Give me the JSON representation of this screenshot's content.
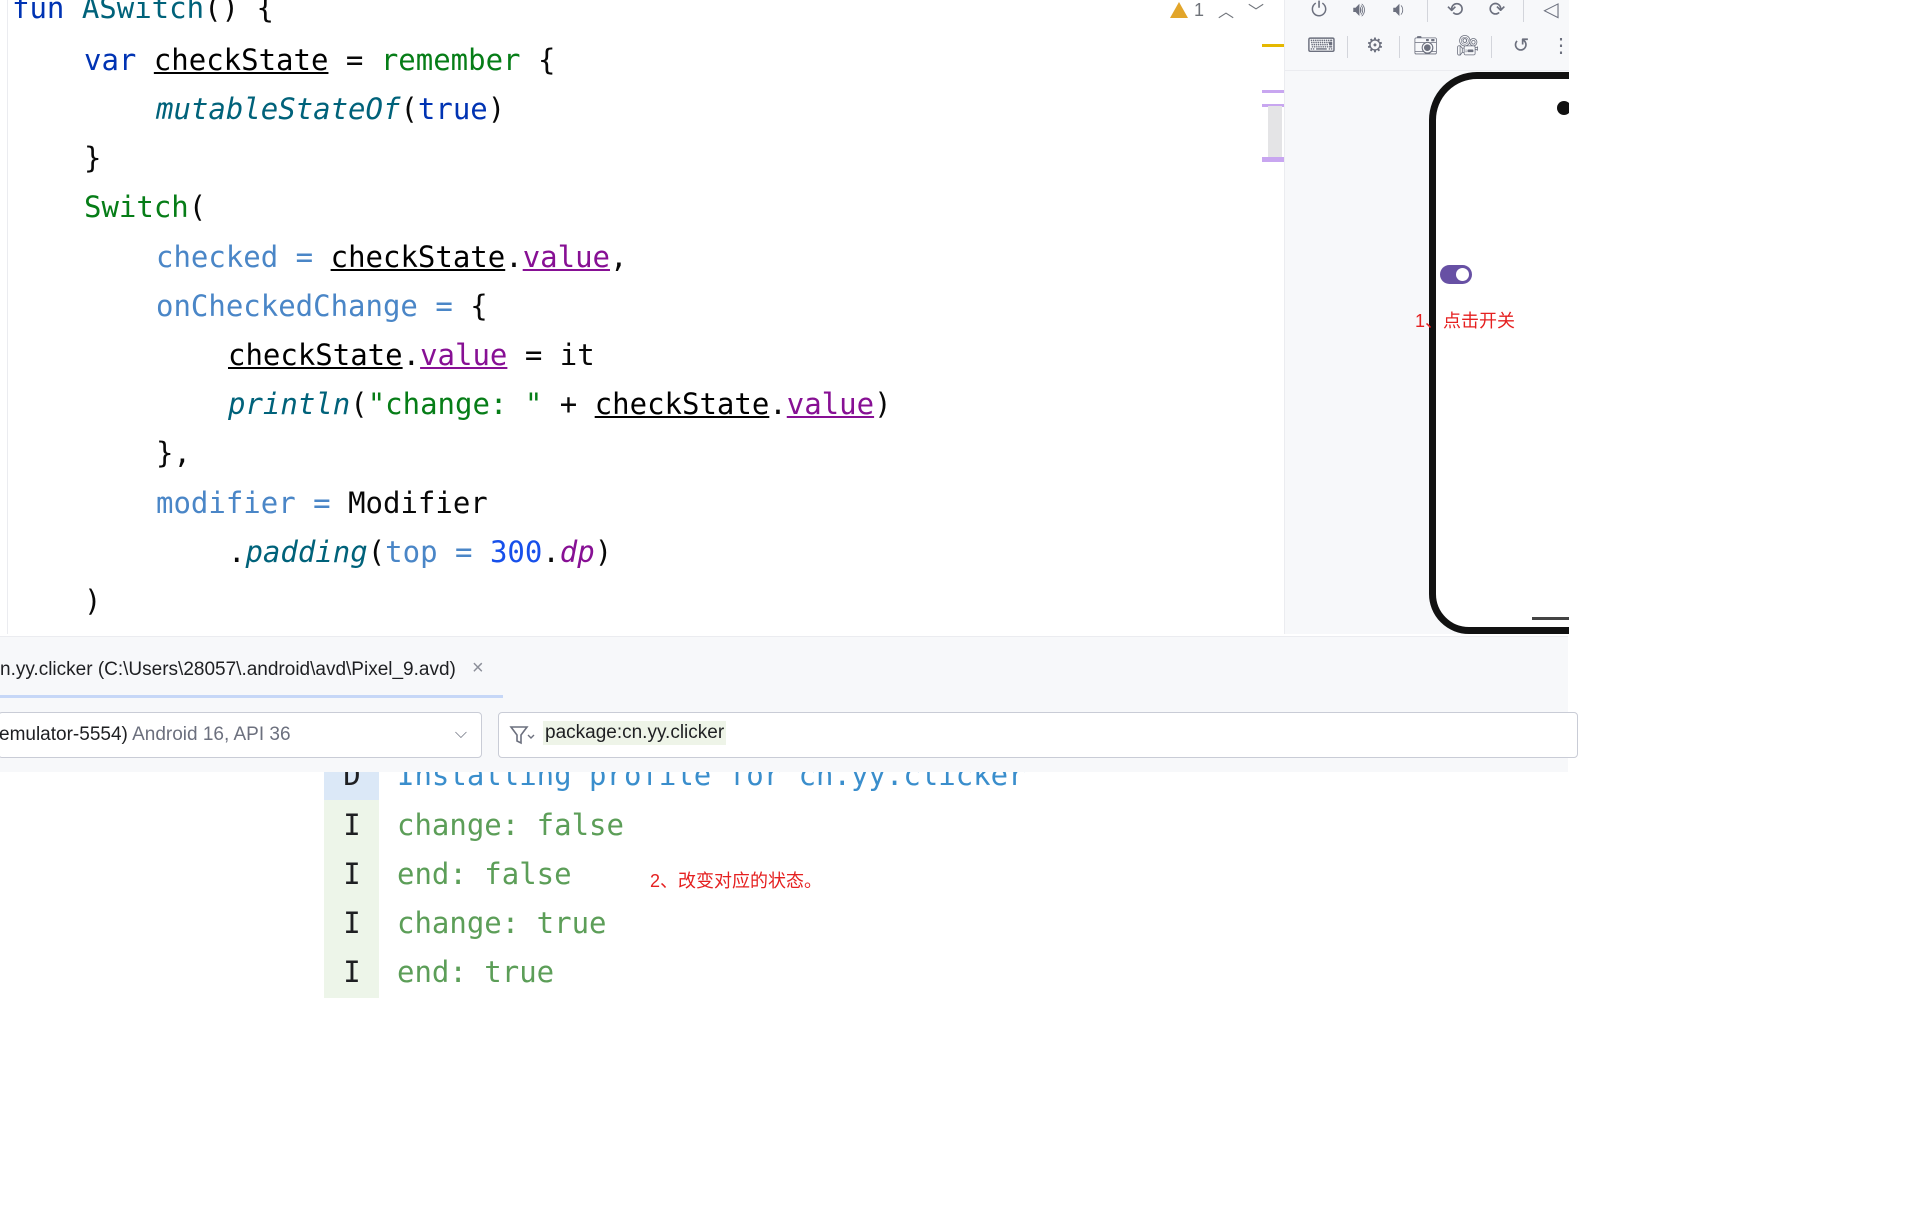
{
  "editor": {
    "lines": [
      {
        "parts": [
          [
            "kw",
            "fun "
          ],
          [
            "fn",
            "ASwitch"
          ],
          [
            "",
            "() {"
          ]
        ]
      },
      {
        "parts": [
          [
            "kw",
            "var "
          ],
          [
            "var",
            "checkState"
          ],
          [
            "",
            " = "
          ],
          [
            "fnc",
            "remember"
          ],
          [
            "",
            " {"
          ]
        ]
      },
      {
        "parts": [
          [
            "it",
            "mutableStateOf"
          ],
          [
            "",
            "("
          ],
          [
            "kw",
            "true"
          ],
          [
            "",
            ")"
          ]
        ]
      },
      {
        "parts": [
          [
            "",
            "}"
          ]
        ]
      },
      {
        "parts": [
          [
            "fnc",
            "Switch"
          ],
          [
            "",
            "("
          ]
        ]
      },
      {
        "parts": [
          [
            "param",
            "checked"
          ],
          [
            "param",
            " = "
          ],
          [
            "var",
            "checkState"
          ],
          [
            "",
            "."
          ],
          [
            "prop",
            "value"
          ],
          [
            "",
            ","
          ]
        ]
      },
      {
        "parts": [
          [
            "param",
            "onCheckedChange"
          ],
          [
            "param",
            " = "
          ],
          [
            "",
            "{"
          ]
        ]
      },
      {
        "parts": [
          [
            "var",
            "checkState"
          ],
          [
            "",
            "."
          ],
          [
            "prop",
            "value"
          ],
          [
            "",
            " = "
          ],
          [
            "",
            "it"
          ]
        ]
      },
      {
        "parts": [
          [
            "it",
            "println"
          ],
          [
            "",
            "("
          ],
          [
            "str",
            "\"change: \""
          ],
          [
            "",
            " + "
          ],
          [
            "var",
            "checkState"
          ],
          [
            "",
            "."
          ],
          [
            "prop",
            "value"
          ],
          [
            "",
            ")"
          ]
        ]
      },
      {
        "parts": [
          [
            "",
            "},"
          ]
        ]
      },
      {
        "parts": [
          [
            "param",
            "modifier"
          ],
          [
            "param",
            " = "
          ],
          [
            "",
            "Modifier"
          ]
        ]
      },
      {
        "parts": [
          [
            "",
            "."
          ],
          [
            "it",
            "padding"
          ],
          [
            "",
            "("
          ],
          [
            "param",
            "top"
          ],
          [
            "param",
            " = "
          ],
          [
            "num",
            "300"
          ],
          [
            "",
            "."
          ],
          [
            "ital2",
            "dp"
          ],
          [
            "",
            ")"
          ]
        ]
      },
      {
        "parts": [
          [
            "",
            ")"
          ]
        ]
      }
    ],
    "warning_count": "1"
  },
  "emulator": {
    "annotation": "1、点击开关",
    "switch_checked": true
  },
  "logcat": {
    "tab_label": "n.yy.clicker (C:\\Users\\28057\\.android\\avd\\Pixel_9.avd)",
    "device_name": "emulator-5554)",
    "device_api": " Android 16, API 36",
    "filter": "package:cn.yy.clicker",
    "rows": [
      {
        "level": "D",
        "message": "Installing profile for cn.yy.clicker"
      },
      {
        "level": "I",
        "message": "change: false"
      },
      {
        "level": "I",
        "message": "end: false"
      },
      {
        "level": "I",
        "message": "change: true"
      },
      {
        "level": "I",
        "message": "end: true"
      }
    ],
    "annotation": "2、改变对应的状态。"
  },
  "colors": {
    "accent": "#3574f0",
    "annotation_red": "#e52020",
    "switch_track": "#6750a4",
    "info_text": "#5c9e58",
    "debug_text": "#3a8ecc"
  }
}
